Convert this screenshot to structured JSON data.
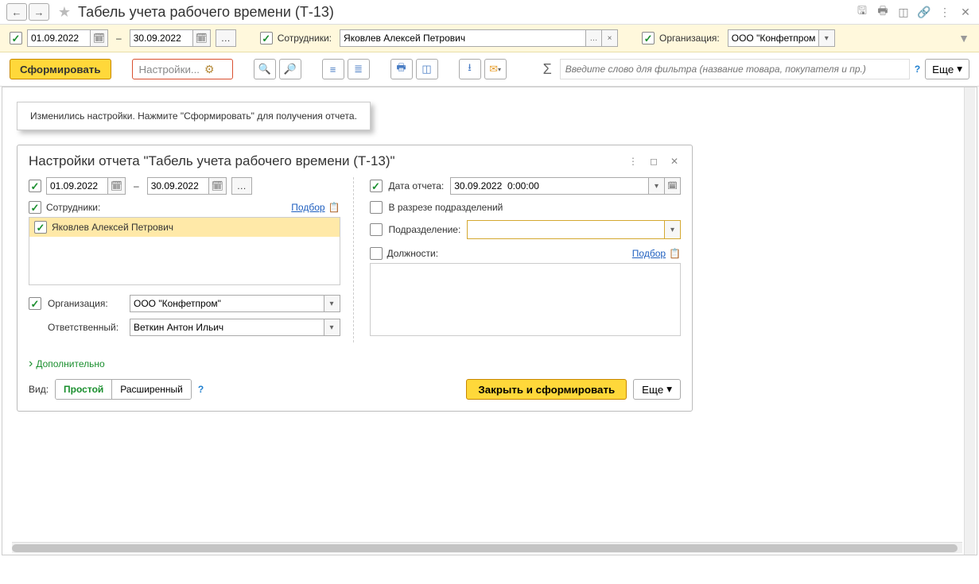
{
  "header": {
    "title": "Табель учета рабочего времени (Т-13)"
  },
  "filter": {
    "date_from": "01.09.2022",
    "date_to": "30.09.2022",
    "employees_label": "Сотрудники:",
    "employees_value": "Яковлев Алексей Петрович",
    "org_label": "Организация:",
    "org_value": "ООО \"Конфетпром\""
  },
  "toolbar": {
    "generate_label": "Сформировать",
    "settings_label": "Настройки...",
    "search_placeholder": "Введите слово для фильтра (название товара, покупателя и пр.)",
    "more_label": "Еще"
  },
  "info_message": "Изменились настройки. Нажмите \"Сформировать\" для получения отчета.",
  "dialog": {
    "title": "Настройки отчета \"Табель учета рабочего времени (Т-13)\"",
    "date_from": "01.09.2022",
    "date_to": "30.09.2022",
    "employees_label": "Сотрудники:",
    "selection_link": "Подбор",
    "employees": [
      "Яковлев Алексей Петрович"
    ],
    "org_label": "Организация:",
    "org_value": "ООО \"Конфетпром\"",
    "responsible_label": "Ответственный:",
    "responsible_value": "Веткин Антон Ильич",
    "report_date_label": "Дата отчета:",
    "report_date_value": "30.09.2022  0:00:00",
    "by_divisions_label": "В разрезе подразделений",
    "division_label": "Подразделение:",
    "division_value": "",
    "positions_label": "Должности:",
    "expand_label": "Дополнительно",
    "view_label": "Вид:",
    "view_simple": "Простой",
    "view_advanced": "Расширенный",
    "close_generate_label": "Закрыть и сформировать",
    "more_label": "Еще"
  }
}
